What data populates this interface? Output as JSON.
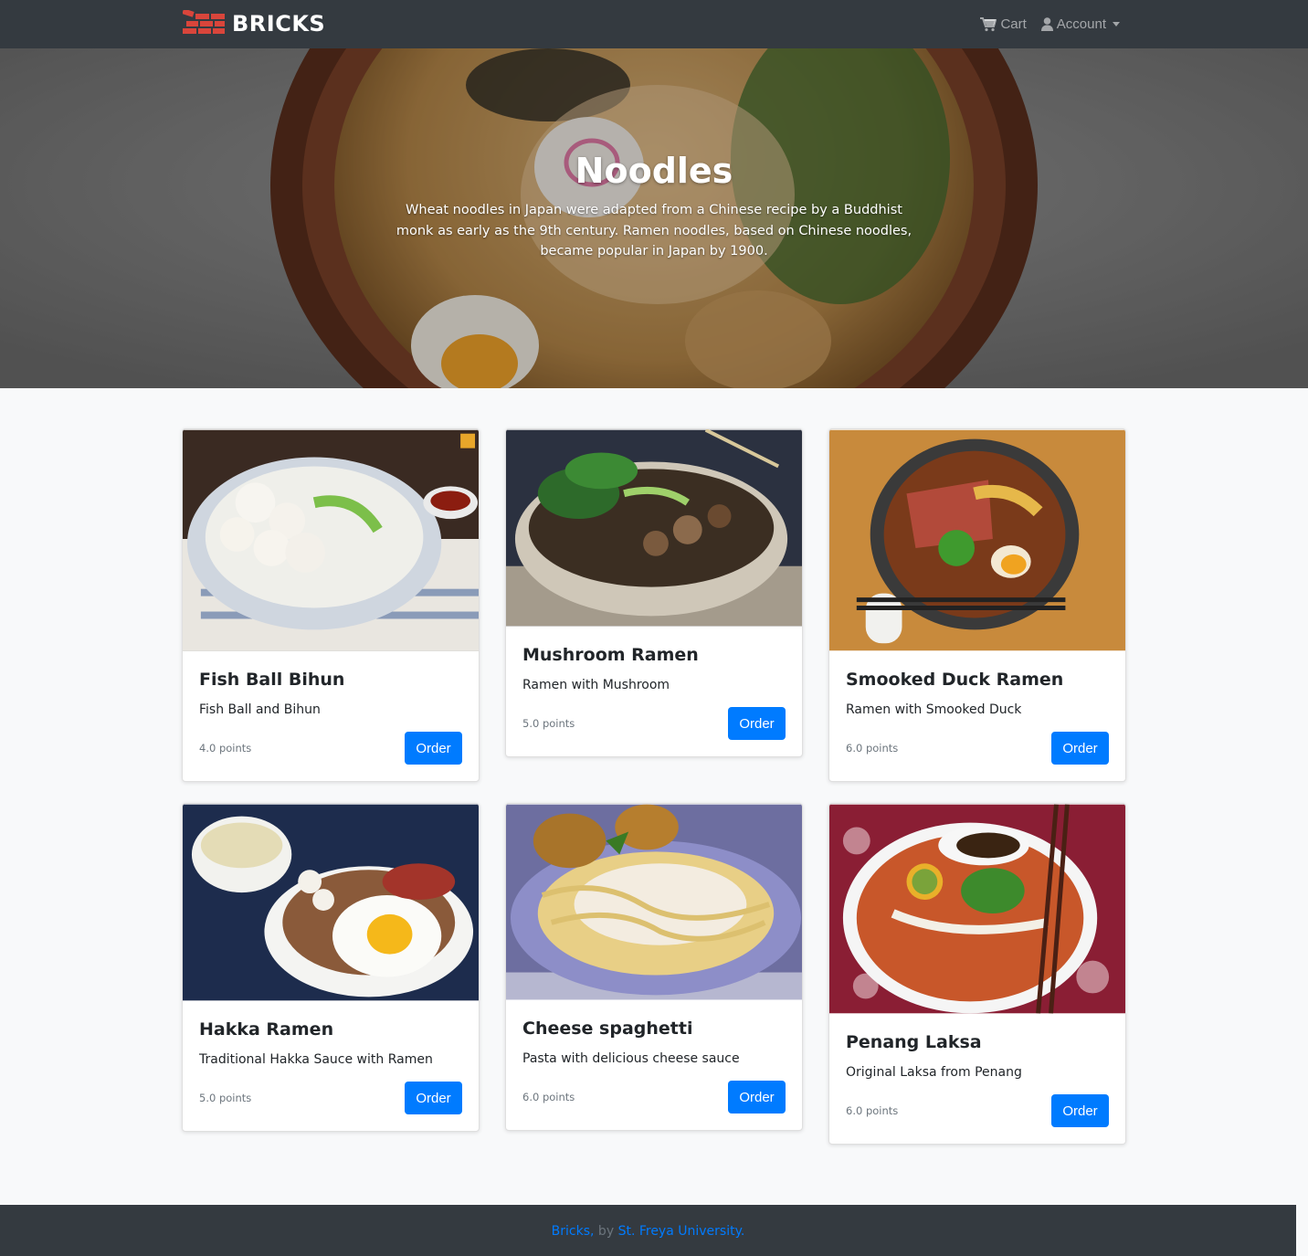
{
  "navbar": {
    "brand": "BRICKS",
    "cart_label": "Cart",
    "account_label": "Account"
  },
  "hero": {
    "title": "Noodles",
    "description": "Wheat noodles in Japan were adapted from a Chinese recipe by a Buddhist monk as early as the 9th century. Ramen noodles, based on Chinese noodles, became popular in Japan by 1900."
  },
  "products": [
    {
      "name": "Fish Ball Bihun",
      "description": "Fish Ball and Bihun",
      "points": "4.0 points",
      "order_label": "Order"
    },
    {
      "name": "Mushroom Ramen",
      "description": "Ramen with Mushroom",
      "points": "5.0 points",
      "order_label": "Order"
    },
    {
      "name": "Smooked Duck Ramen",
      "description": "Ramen with Smooked Duck",
      "points": "6.0 points",
      "order_label": "Order"
    },
    {
      "name": "Hakka Ramen",
      "description": "Traditional Hakka Sauce with Ramen",
      "points": "5.0 points",
      "order_label": "Order"
    },
    {
      "name": "Cheese spaghetti",
      "description": "Pasta with delicious cheese sauce",
      "points": "6.0 points",
      "order_label": "Order"
    },
    {
      "name": "Penang Laksa",
      "description": "Original Laksa from Penang",
      "points": "6.0 points",
      "order_label": "Order"
    }
  ],
  "footer": {
    "brand_link": "Bricks,",
    "by_text": " by ",
    "university_link": "St. Freya University."
  },
  "colors": {
    "navbar_bg": "#343a40",
    "primary": "#007bff",
    "page_bg": "#f8f9fa",
    "logo_red": "#d9453b"
  }
}
